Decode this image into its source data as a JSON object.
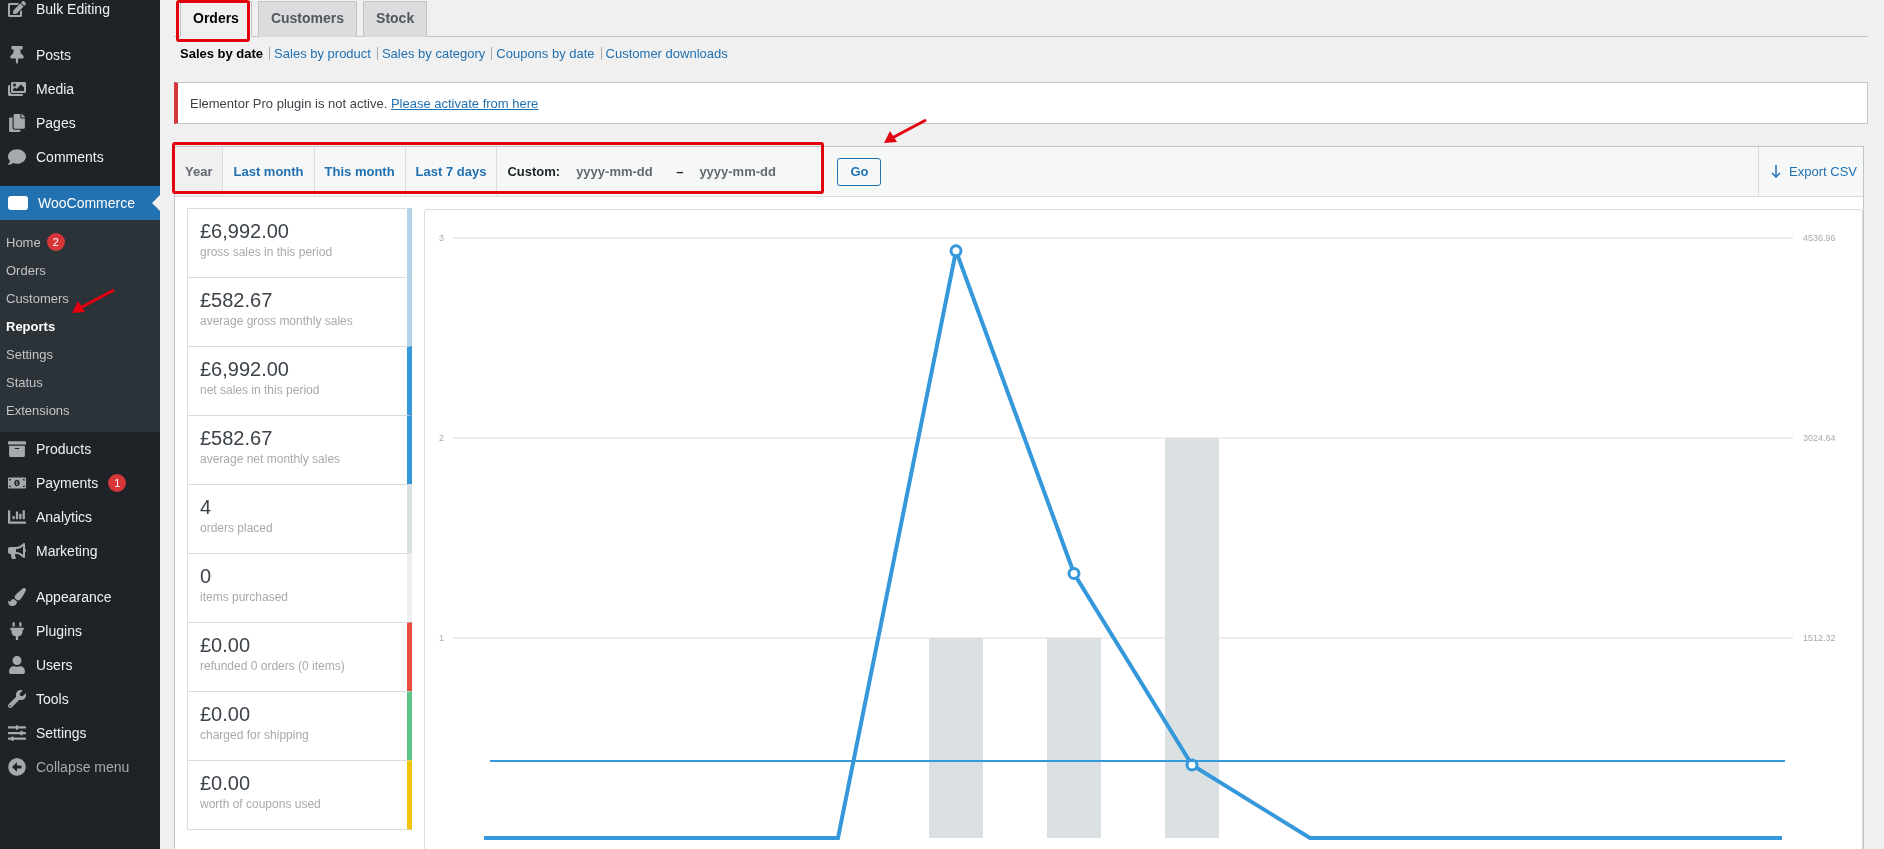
{
  "sidebar": {
    "items": [
      {
        "label": "Bulk Editing",
        "selected": false,
        "gap_before": false
      },
      {
        "label": "Posts",
        "selected": false,
        "gap_before": true
      },
      {
        "label": "Media",
        "selected": false,
        "gap_before": false
      },
      {
        "label": "Pages",
        "selected": false,
        "gap_before": false
      },
      {
        "label": "Comments",
        "selected": false,
        "gap_before": false
      },
      {
        "label": "WooCommerce",
        "selected": true,
        "gap_before": true,
        "expanded": true,
        "children": [
          {
            "label": "Home",
            "selected": false,
            "badge": "2"
          },
          {
            "label": "Orders",
            "selected": false
          },
          {
            "label": "Customers",
            "selected": false
          },
          {
            "label": "Reports",
            "selected": true
          },
          {
            "label": "Settings",
            "selected": false
          },
          {
            "label": "Status",
            "selected": false
          },
          {
            "label": "Extensions",
            "selected": false
          }
        ]
      },
      {
        "label": "Products",
        "selected": false,
        "gap_before": false
      },
      {
        "label": "Payments",
        "selected": false,
        "gap_before": false,
        "badge": "1"
      },
      {
        "label": "Analytics",
        "selected": false,
        "gap_before": false
      },
      {
        "label": "Marketing",
        "selected": false,
        "gap_before": false
      },
      {
        "label": "Appearance",
        "selected": false,
        "gap_before": true
      },
      {
        "label": "Plugins",
        "selected": false,
        "gap_before": false
      },
      {
        "label": "Users",
        "selected": false,
        "gap_before": false
      },
      {
        "label": "Tools",
        "selected": false,
        "gap_before": false
      },
      {
        "label": "Settings",
        "selected": false,
        "gap_before": false
      },
      {
        "label": "Collapse menu",
        "selected": false,
        "gap_before": false,
        "kind": "collapse"
      }
    ]
  },
  "tabs": [
    {
      "label": "Orders",
      "selected": true
    },
    {
      "label": "Customers",
      "selected": false
    },
    {
      "label": "Stock",
      "selected": false
    }
  ],
  "subnav": [
    {
      "label": "Sales by date",
      "selected": true
    },
    {
      "label": "Sales by product",
      "selected": false
    },
    {
      "label": "Sales by category",
      "selected": false
    },
    {
      "label": "Coupons by date",
      "selected": false
    },
    {
      "label": "Customer downloads",
      "selected": false
    }
  ],
  "notice": {
    "message": "Elementor Pro plugin is not active.",
    "link": "Please activate from here"
  },
  "range": {
    "options": [
      {
        "label": "Year",
        "selected": true
      },
      {
        "label": "Last month",
        "selected": false
      },
      {
        "label": "This month",
        "selected": false
      },
      {
        "label": "Last 7 days",
        "selected": false
      }
    ],
    "custom_label": "Custom:",
    "start": {
      "placeholder": "yyyy-mm-dd"
    },
    "separator": "–",
    "end": {
      "placeholder": "yyyy-mm-dd"
    },
    "go": "Go",
    "export": "Export CSV"
  },
  "stats": [
    {
      "value": "£6,992.00",
      "label": "gross sales in this period",
      "color": "#b1d4ea"
    },
    {
      "value": "£582.67",
      "label": "average gross monthly sales",
      "color": "#b1d4ea"
    },
    {
      "value": "£6,992.00",
      "label": "net sales in this period",
      "color": "#3498db"
    },
    {
      "value": "£582.67",
      "label": "average net monthly sales",
      "color": "#3498db"
    },
    {
      "value": "4",
      "label": "orders placed",
      "color": "#dbe1e3"
    },
    {
      "value": "0",
      "label": "items purchased",
      "color": "#ecf0f1"
    },
    {
      "value": "£0.00",
      "label": "refunded 0 orders (0 items)",
      "color": "#e74c3c"
    },
    {
      "value": "£0.00",
      "label": "charged for shipping",
      "color": "#5cc488"
    },
    {
      "value": "£0.00",
      "label": "worth of coupons used",
      "color": "#f1c40f"
    }
  ],
  "chart": {
    "chart_data": {
      "type": "bar",
      "ylim": [
        0,
        3
      ],
      "yticks": [
        1,
        2,
        3
      ],
      "y2lim": [
        0,
        4536.96
      ],
      "y2ticks": [
        {
          "value": 1512.32,
          "label": "1512.32"
        },
        {
          "value": 3024.64,
          "label": "3024.64"
        },
        {
          "value": 4536.96,
          "label": "4536.96"
        }
      ],
      "series": [
        {
          "type": "bar",
          "color": "#dbe1e3",
          "values": [
            0,
            0,
            0,
            0,
            1,
            1,
            2,
            0,
            0,
            0,
            0,
            0
          ]
        },
        {
          "type": "line",
          "axis": "y2",
          "color": "#3498db",
          "values": [
            0,
            0,
            0,
            0,
            4440,
            2000,
            552,
            0,
            0,
            0,
            0,
            0
          ]
        }
      ],
      "stacked": false,
      "ref_lines": [
        {
          "value": 582.67,
          "axis": "y2",
          "color": "#3498db"
        }
      ]
    }
  }
}
